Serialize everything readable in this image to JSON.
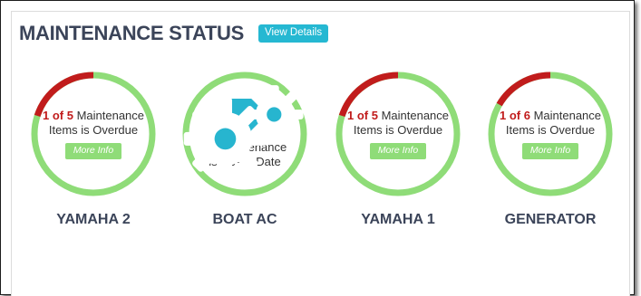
{
  "header": {
    "title": "MAINTENANCE STATUS",
    "view_details_label": "View Details"
  },
  "colors": {
    "ring_ok": "#8fdc78",
    "ring_overdue": "#c11c1c",
    "accent": "#25b8d2",
    "title": "#3b4459"
  },
  "gauges": [
    {
      "name": "YAMAHA 2",
      "overdue": "1 of 5",
      "status_suffix": " Maintenance",
      "status_line2": "Items is Overdue",
      "more_info": "More Info",
      "overdue_fraction": 0.2
    },
    {
      "name": "BOAT AC",
      "icon": "gears-icon",
      "status_line1": "All Maintenance",
      "status_line2": "is Up-To-Date",
      "overdue_fraction": 0
    },
    {
      "name": "YAMAHA 1",
      "overdue": "1 of 5",
      "status_suffix": " Maintenance",
      "status_line2": "Items is Overdue",
      "more_info": "More Info",
      "overdue_fraction": 0.2
    },
    {
      "name": "GENERATOR",
      "overdue": "1 of 6",
      "status_suffix": " Maintenance",
      "status_line2": "Items is Overdue",
      "more_info": "More Info",
      "overdue_fraction": 0.1667
    }
  ]
}
